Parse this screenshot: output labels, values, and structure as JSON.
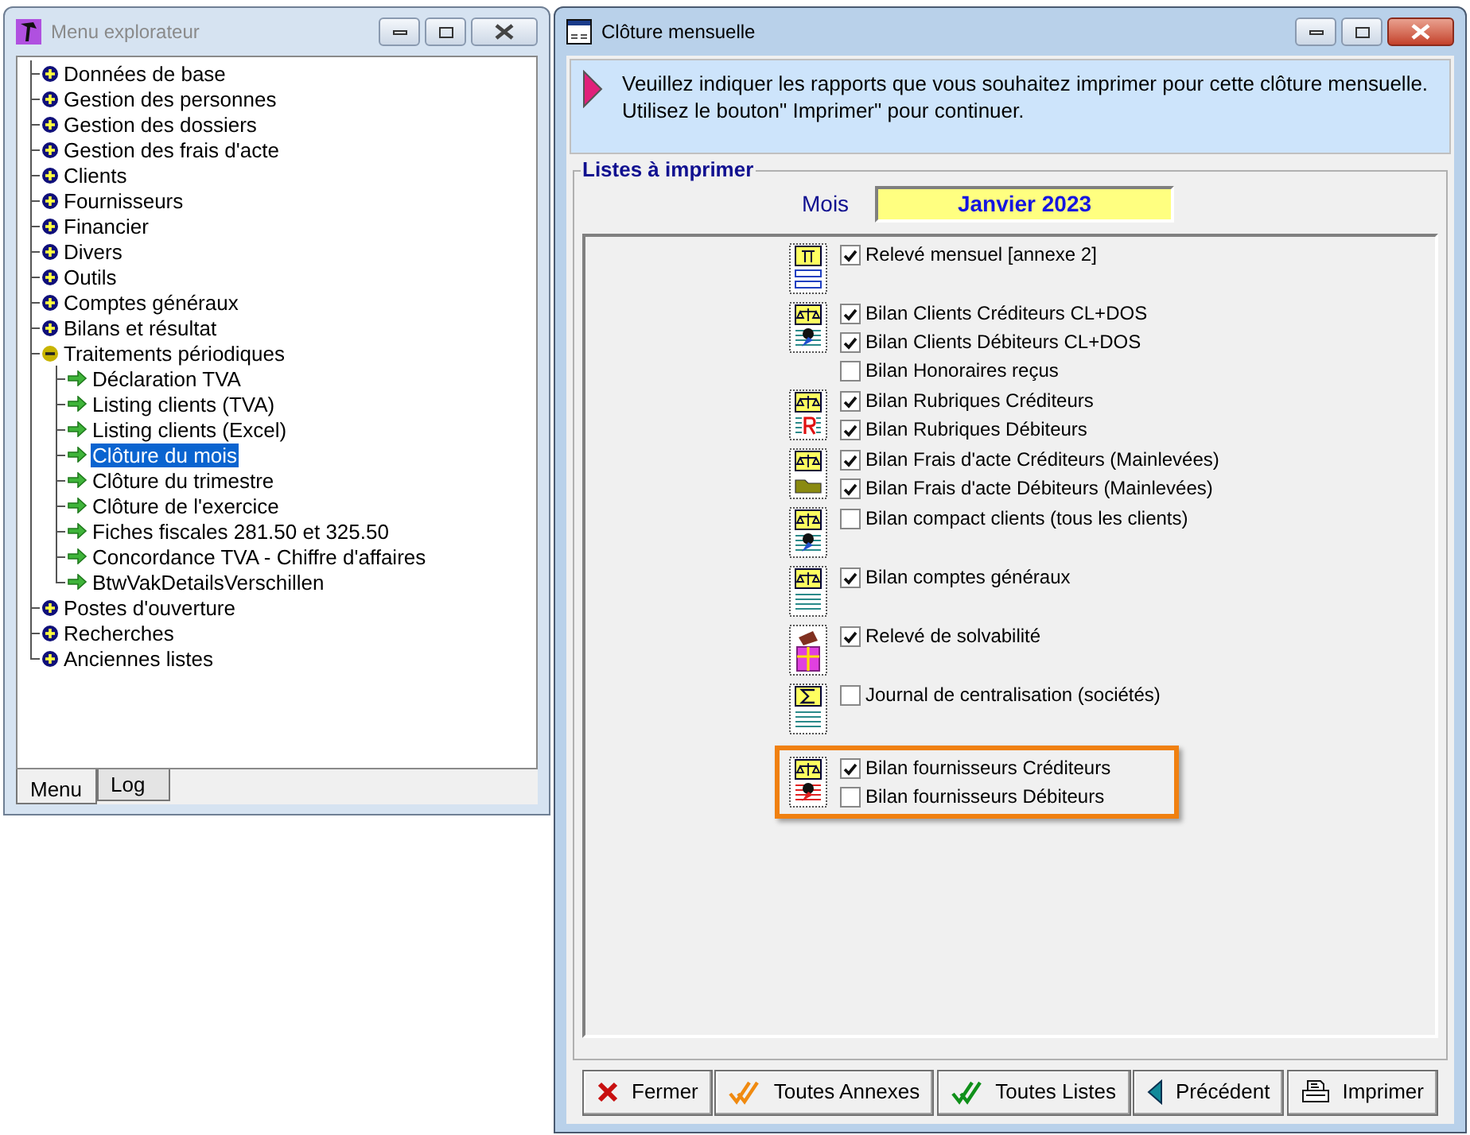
{
  "explorer": {
    "title": "Menu explorateur",
    "tree": [
      {
        "label": "Données de base",
        "expanded": false,
        "selected": false
      },
      {
        "label": "Gestion des personnes",
        "expanded": false,
        "selected": false
      },
      {
        "label": "Gestion des dossiers",
        "expanded": false,
        "selected": false
      },
      {
        "label": "Gestion des frais d'acte",
        "expanded": false,
        "selected": false
      },
      {
        "label": "Clients",
        "expanded": false,
        "selected": false
      },
      {
        "label": "Fournisseurs",
        "expanded": false,
        "selected": false
      },
      {
        "label": "Financier",
        "expanded": false,
        "selected": false
      },
      {
        "label": "Divers",
        "expanded": false,
        "selected": false
      },
      {
        "label": "Outils",
        "expanded": false,
        "selected": false
      },
      {
        "label": "Comptes généraux",
        "expanded": false,
        "selected": false
      },
      {
        "label": "Bilans et résultat",
        "expanded": false,
        "selected": false
      },
      {
        "label": "Traitements périodiques",
        "expanded": true,
        "selected": false,
        "children": [
          {
            "label": "Déclaration TVA",
            "selected": false
          },
          {
            "label": "Listing clients (TVA)",
            "selected": false
          },
          {
            "label": "Listing clients (Excel)",
            "selected": false
          },
          {
            "label": "Clôture du mois",
            "selected": true
          },
          {
            "label": "Clôture du trimestre",
            "selected": false
          },
          {
            "label": "Clôture de l'exercice",
            "selected": false
          },
          {
            "label": "Fiches fiscales 281.50 et 325.50",
            "selected": false
          },
          {
            "label": "Concordance TVA - Chiffre d'affaires",
            "selected": false
          },
          {
            "label": "BtwVakDetailsVerschillen",
            "selected": false
          }
        ]
      },
      {
        "label": "Postes d'ouverture",
        "expanded": false,
        "selected": false
      },
      {
        "label": "Recherches",
        "expanded": false,
        "selected": false
      },
      {
        "label": "Anciennes listes",
        "expanded": false,
        "selected": false
      }
    ],
    "tabs": [
      {
        "label": "Menu",
        "selected": true
      },
      {
        "label": "Log",
        "selected": false
      }
    ]
  },
  "dialog": {
    "title": "Clôture mensuelle",
    "instructions": [
      "Veuillez indiquer les rapports que vous souhaitez imprimer pour cette clôture mensuelle.",
      "Utilisez le bouton\" Imprimer\" pour continuer."
    ],
    "group_title": "Listes à imprimer",
    "month_label": "Mois",
    "month_value": "Janvier 2023",
    "report_groups": [
      {
        "kind": "statement",
        "highlighted": false,
        "items": [
          {
            "label": "Relevé mensuel [annexe 2]",
            "checked": true
          }
        ]
      },
      {
        "kind": "balance-person",
        "highlighted": false,
        "items": [
          {
            "label": "Bilan Clients Créditeurs CL+DOS",
            "checked": true
          },
          {
            "label": "Bilan Clients Débiteurs CL+DOS",
            "checked": true
          },
          {
            "label": "Bilan Honoraires reçus",
            "checked": false
          }
        ]
      },
      {
        "kind": "balance-letter",
        "highlighted": false,
        "items": [
          {
            "label": "Bilan Rubriques Créditeurs",
            "checked": true
          },
          {
            "label": "Bilan Rubriques Débiteurs",
            "checked": true
          }
        ]
      },
      {
        "kind": "balance-folder",
        "highlighted": false,
        "items": [
          {
            "label": "Bilan Frais d'acte Créditeurs (Mainlevées)",
            "checked": true
          },
          {
            "label": "Bilan Frais d'acte Débiteurs (Mainlevées)",
            "checked": true
          }
        ]
      },
      {
        "kind": "balance-person",
        "highlighted": false,
        "items": [
          {
            "label": "Bilan compact clients (tous les clients)",
            "checked": false
          }
        ]
      },
      {
        "kind": "balance-lines",
        "highlighted": false,
        "items": [
          {
            "label": "Bilan comptes généraux",
            "checked": true
          }
        ]
      },
      {
        "kind": "gift",
        "highlighted": false,
        "items": [
          {
            "label": "Relevé de solvabilité",
            "checked": true
          }
        ]
      },
      {
        "kind": "sigma",
        "highlighted": false,
        "items": [
          {
            "label": "Journal de centralisation (sociétés)",
            "checked": false
          }
        ]
      },
      {
        "kind": "balance-person-red",
        "highlighted": true,
        "items": [
          {
            "label": "Bilan fournisseurs Créditeurs",
            "checked": true
          },
          {
            "label": "Bilan fournisseurs Débiteurs",
            "checked": false
          }
        ]
      }
    ],
    "buttons": [
      {
        "kind": "close",
        "label": "Fermer"
      },
      {
        "kind": "check-orange",
        "label": "Toutes Annexes"
      },
      {
        "kind": "check-green",
        "label": "Toutes Listes"
      },
      {
        "kind": "back",
        "label": "Précédent"
      },
      {
        "kind": "print",
        "label": "Imprimer"
      }
    ]
  }
}
